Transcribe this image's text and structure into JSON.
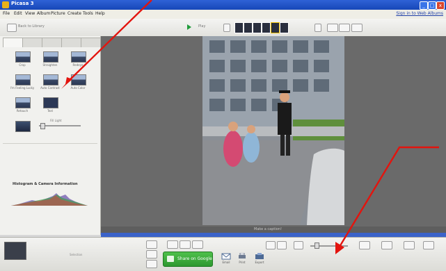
{
  "window": {
    "title": "Picasa 3",
    "min_label": "_",
    "max_label": "□",
    "close_label": "x"
  },
  "menu": {
    "items": [
      "File",
      "Edit",
      "View",
      "Album",
      "Picture",
      "Create",
      "Tools",
      "Help"
    ],
    "signin": "Sign in to Web Albums"
  },
  "toolbar": {
    "back_label": "Back to Library",
    "play_label": "Play"
  },
  "tools_panel": {
    "tools": [
      {
        "label": "Crop"
      },
      {
        "label": "Straighten"
      },
      {
        "label": "Redeye"
      },
      {
        "label": "I'm Feeling Lucky"
      },
      {
        "label": "Auto Contrast"
      },
      {
        "label": "Auto Color"
      },
      {
        "label": "Retouch"
      },
      {
        "label": "Text"
      }
    ],
    "fill_light_label": "Fill Light",
    "undo_label": "",
    "redo_label": "",
    "histogram_title": "Histogram & Camera Information",
    "camera_info": [
      "",
      "",
      "",
      "",
      ""
    ]
  },
  "main": {
    "caption_placeholder": "Make a caption!"
  },
  "status": {
    "text": ""
  },
  "tray": {
    "selection_label": "Selection",
    "share_label": "Share on Google",
    "email_label": "Email",
    "print_label": "Print",
    "export_label": "Export"
  },
  "colors": {
    "titlebar": "#1747b8",
    "share_green": "#2d9830",
    "arrow_red": "#e3140e"
  }
}
